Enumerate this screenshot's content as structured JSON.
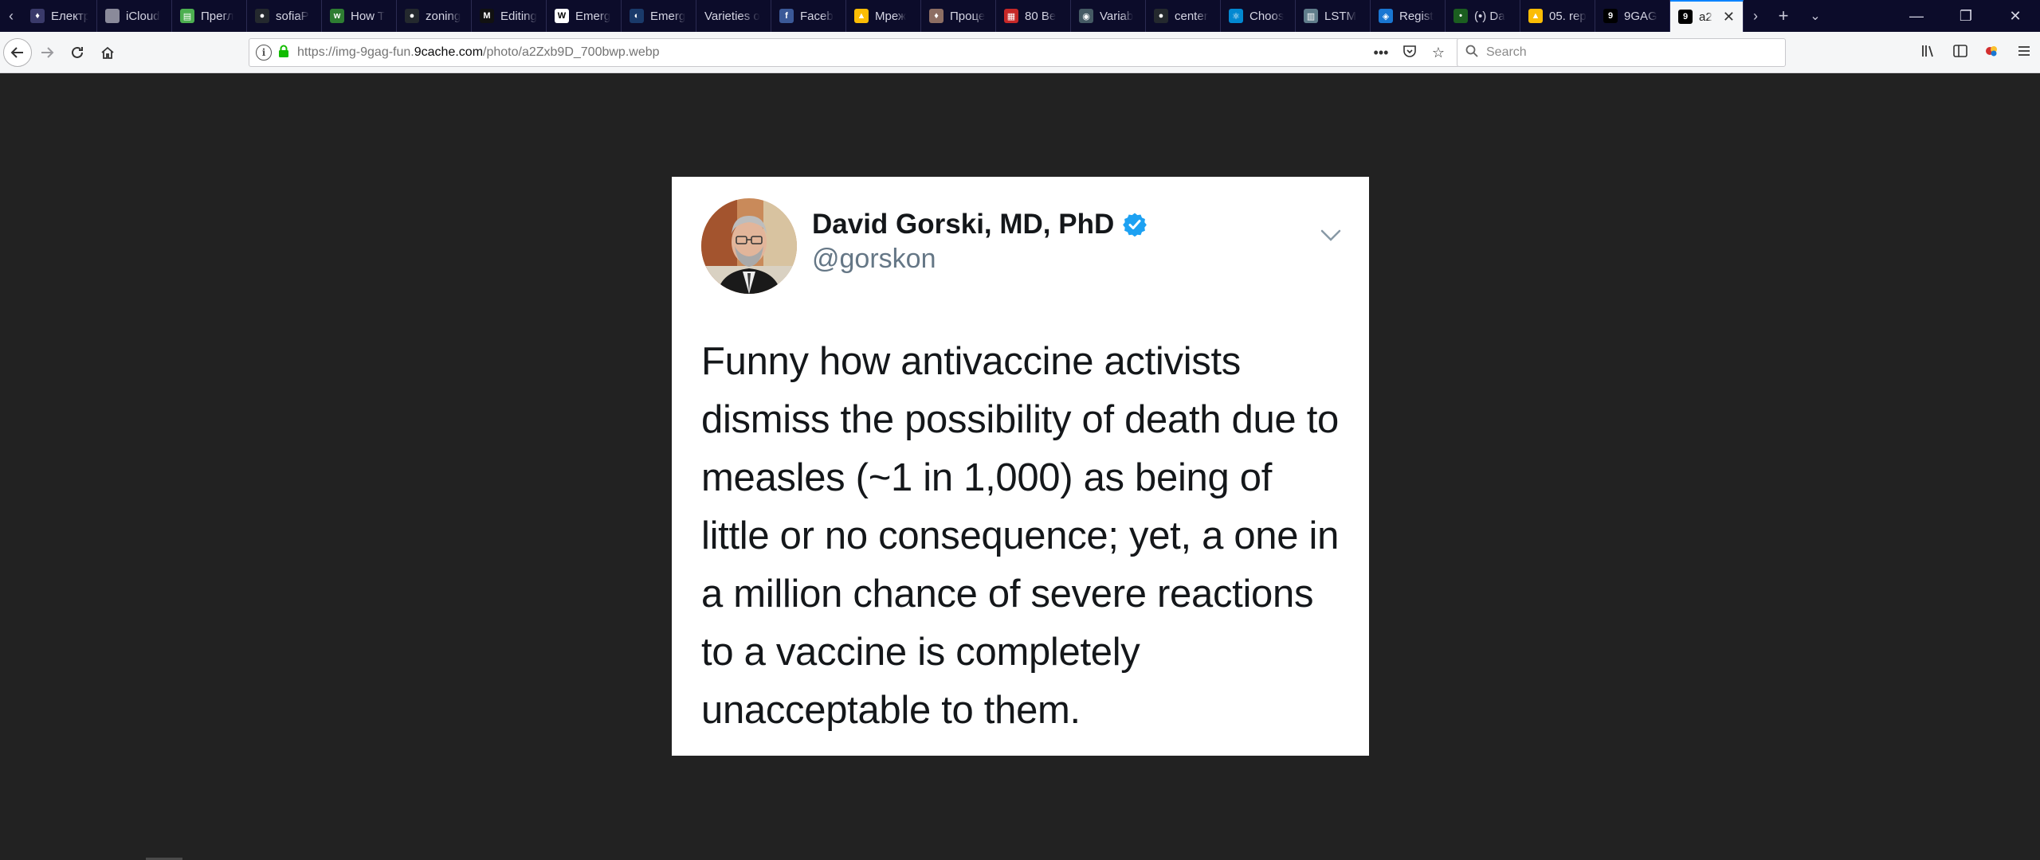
{
  "browser": {
    "tabs": [
      {
        "label": "Електр",
        "favicon": "dark-emblem-icon",
        "color": "#3a3a6a",
        "glyph": "♦"
      },
      {
        "label": "iCloud",
        "favicon": "icloud-icon",
        "color": "#8a8a9a",
        "glyph": ""
      },
      {
        "label": "Прегл",
        "favicon": "green-doc-icon",
        "color": "#4caf50",
        "glyph": "▤"
      },
      {
        "label": "sofiaP",
        "favicon": "github-icon",
        "color": "#24292e",
        "glyph": "●"
      },
      {
        "label": "How T",
        "favicon": "green-logo-icon",
        "color": "#2e7d32",
        "glyph": "w"
      },
      {
        "label": "zoning",
        "favicon": "github-icon",
        "color": "#24292e",
        "glyph": "●"
      },
      {
        "label": "Editing",
        "favicon": "medium-icon",
        "color": "#111111",
        "glyph": "M"
      },
      {
        "label": "Emerg",
        "favicon": "wikipedia-icon",
        "color": "#ffffff",
        "glyph": "W"
      },
      {
        "label": "Emerg",
        "favicon": "circle-logo-icon",
        "color": "#1a3a6a",
        "glyph": "◐"
      },
      {
        "label": "Varieties o",
        "favicon": "",
        "color": "",
        "glyph": ""
      },
      {
        "label": "Faceb",
        "favicon": "facebook-icon",
        "color": "#3b5998",
        "glyph": "f"
      },
      {
        "label": "Мреж",
        "favicon": "google-drive-icon",
        "color": "#fbbc04",
        "glyph": "▲"
      },
      {
        "label": "Проце",
        "favicon": "pin-icon",
        "color": "#8d6e63",
        "glyph": "♦"
      },
      {
        "label": "80 Be",
        "favicon": "book-icon",
        "color": "#c62828",
        "glyph": "▦"
      },
      {
        "label": "Variab",
        "favicon": "settings-logo-icon",
        "color": "#455a64",
        "glyph": "◉"
      },
      {
        "label": "center",
        "favicon": "github-icon",
        "color": "#24292e",
        "glyph": "●"
      },
      {
        "label": "Choos",
        "favicon": "react-icon",
        "color": "#0288d1",
        "glyph": "⚛"
      },
      {
        "label": "LSTM",
        "favicon": "image-icon",
        "color": "#607d8b",
        "glyph": "▥"
      },
      {
        "label": "Regist",
        "favicon": "registration-icon",
        "color": "#1976d2",
        "glyph": "◈"
      },
      {
        "label": "(•) Da",
        "favicon": "green-dot-icon",
        "color": "#1b5e20",
        "glyph": "•"
      },
      {
        "label": "05. rep",
        "favicon": "google-drive-icon",
        "color": "#fbbc04",
        "glyph": "▲"
      },
      {
        "label": "9GAG",
        "favicon": "9gag-icon",
        "color": "#000000",
        "glyph": "9"
      },
      {
        "label": "a2",
        "favicon": "9gag-icon",
        "color": "#000000",
        "glyph": "9",
        "active": true
      }
    ],
    "url": {
      "prefix": "https://img-9gag-fun.",
      "domain": "9cache.com",
      "path": "/photo/a2Zxb9D_700bwp.webp"
    },
    "search_placeholder": "Search"
  },
  "tweet": {
    "author_name": "David Gorski, MD, PhD",
    "handle": "@gorskon",
    "text": "Funny how antivaccine activists dismiss the possibility of death due to measles (~1 in 1,000) as being of little or no consequence; yet, a one in a million chance of severe reactions to a vaccine is completely unacceptable to them.",
    "verified_color": "#1da1f2"
  }
}
